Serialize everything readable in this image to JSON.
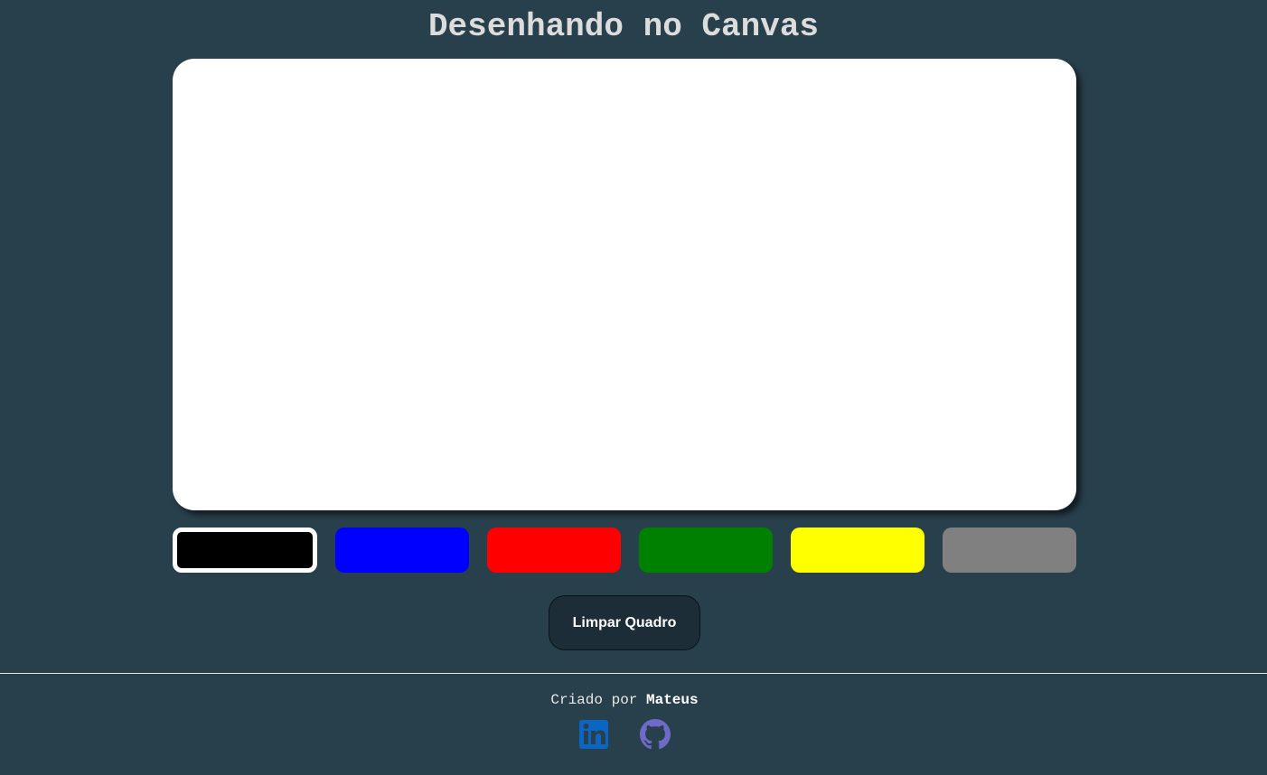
{
  "header": {
    "title": "Desenhando no Canvas"
  },
  "palette": {
    "selected": "black",
    "colors": [
      {
        "name": "black",
        "hex": "#000000"
      },
      {
        "name": "blue",
        "hex": "#0000ff"
      },
      {
        "name": "red",
        "hex": "#ff0000"
      },
      {
        "name": "green",
        "hex": "#008000"
      },
      {
        "name": "yellow",
        "hex": "#ffff00"
      },
      {
        "name": "gray",
        "hex": "#808080"
      }
    ]
  },
  "actions": {
    "clear_label": "Limpar Quadro"
  },
  "footer": {
    "credit_prefix": "Criado por",
    "author": "Mateus",
    "links": [
      {
        "icon": "linkedin-icon",
        "color": "#0a66c2"
      },
      {
        "icon": "github-icon",
        "color": "#6e6ac8"
      }
    ]
  },
  "theme": {
    "background": "#283f4c",
    "canvas": "#ffffff",
    "button_bg": "#1c2d38"
  }
}
